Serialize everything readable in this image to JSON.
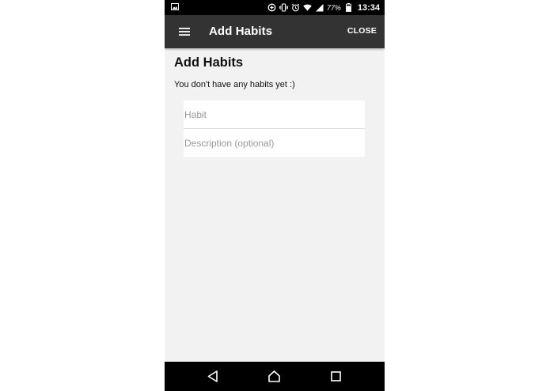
{
  "status_bar": {
    "battery_percent": "77%",
    "time": "13:34",
    "icons": [
      "image-icon",
      "data-saver-icon",
      "vibrate-icon",
      "alarm-icon",
      "wifi-icon",
      "signal-icon",
      "battery-icon"
    ]
  },
  "app_bar": {
    "title": "Add Habits",
    "close_label": "CLOSE"
  },
  "main": {
    "heading": "Add Habits",
    "empty_message": "You don't have any habits yet :)",
    "habit_field": {
      "value": "",
      "placeholder": "Habit"
    },
    "description_field": {
      "value": "",
      "placeholder": "Description (optional)"
    }
  },
  "nav_bar": {
    "icons": [
      "back-icon",
      "home-icon",
      "recents-icon"
    ]
  },
  "colors": {
    "app_bar": "#333333",
    "background": "#f2f2f2",
    "status_bar": "#000000"
  }
}
